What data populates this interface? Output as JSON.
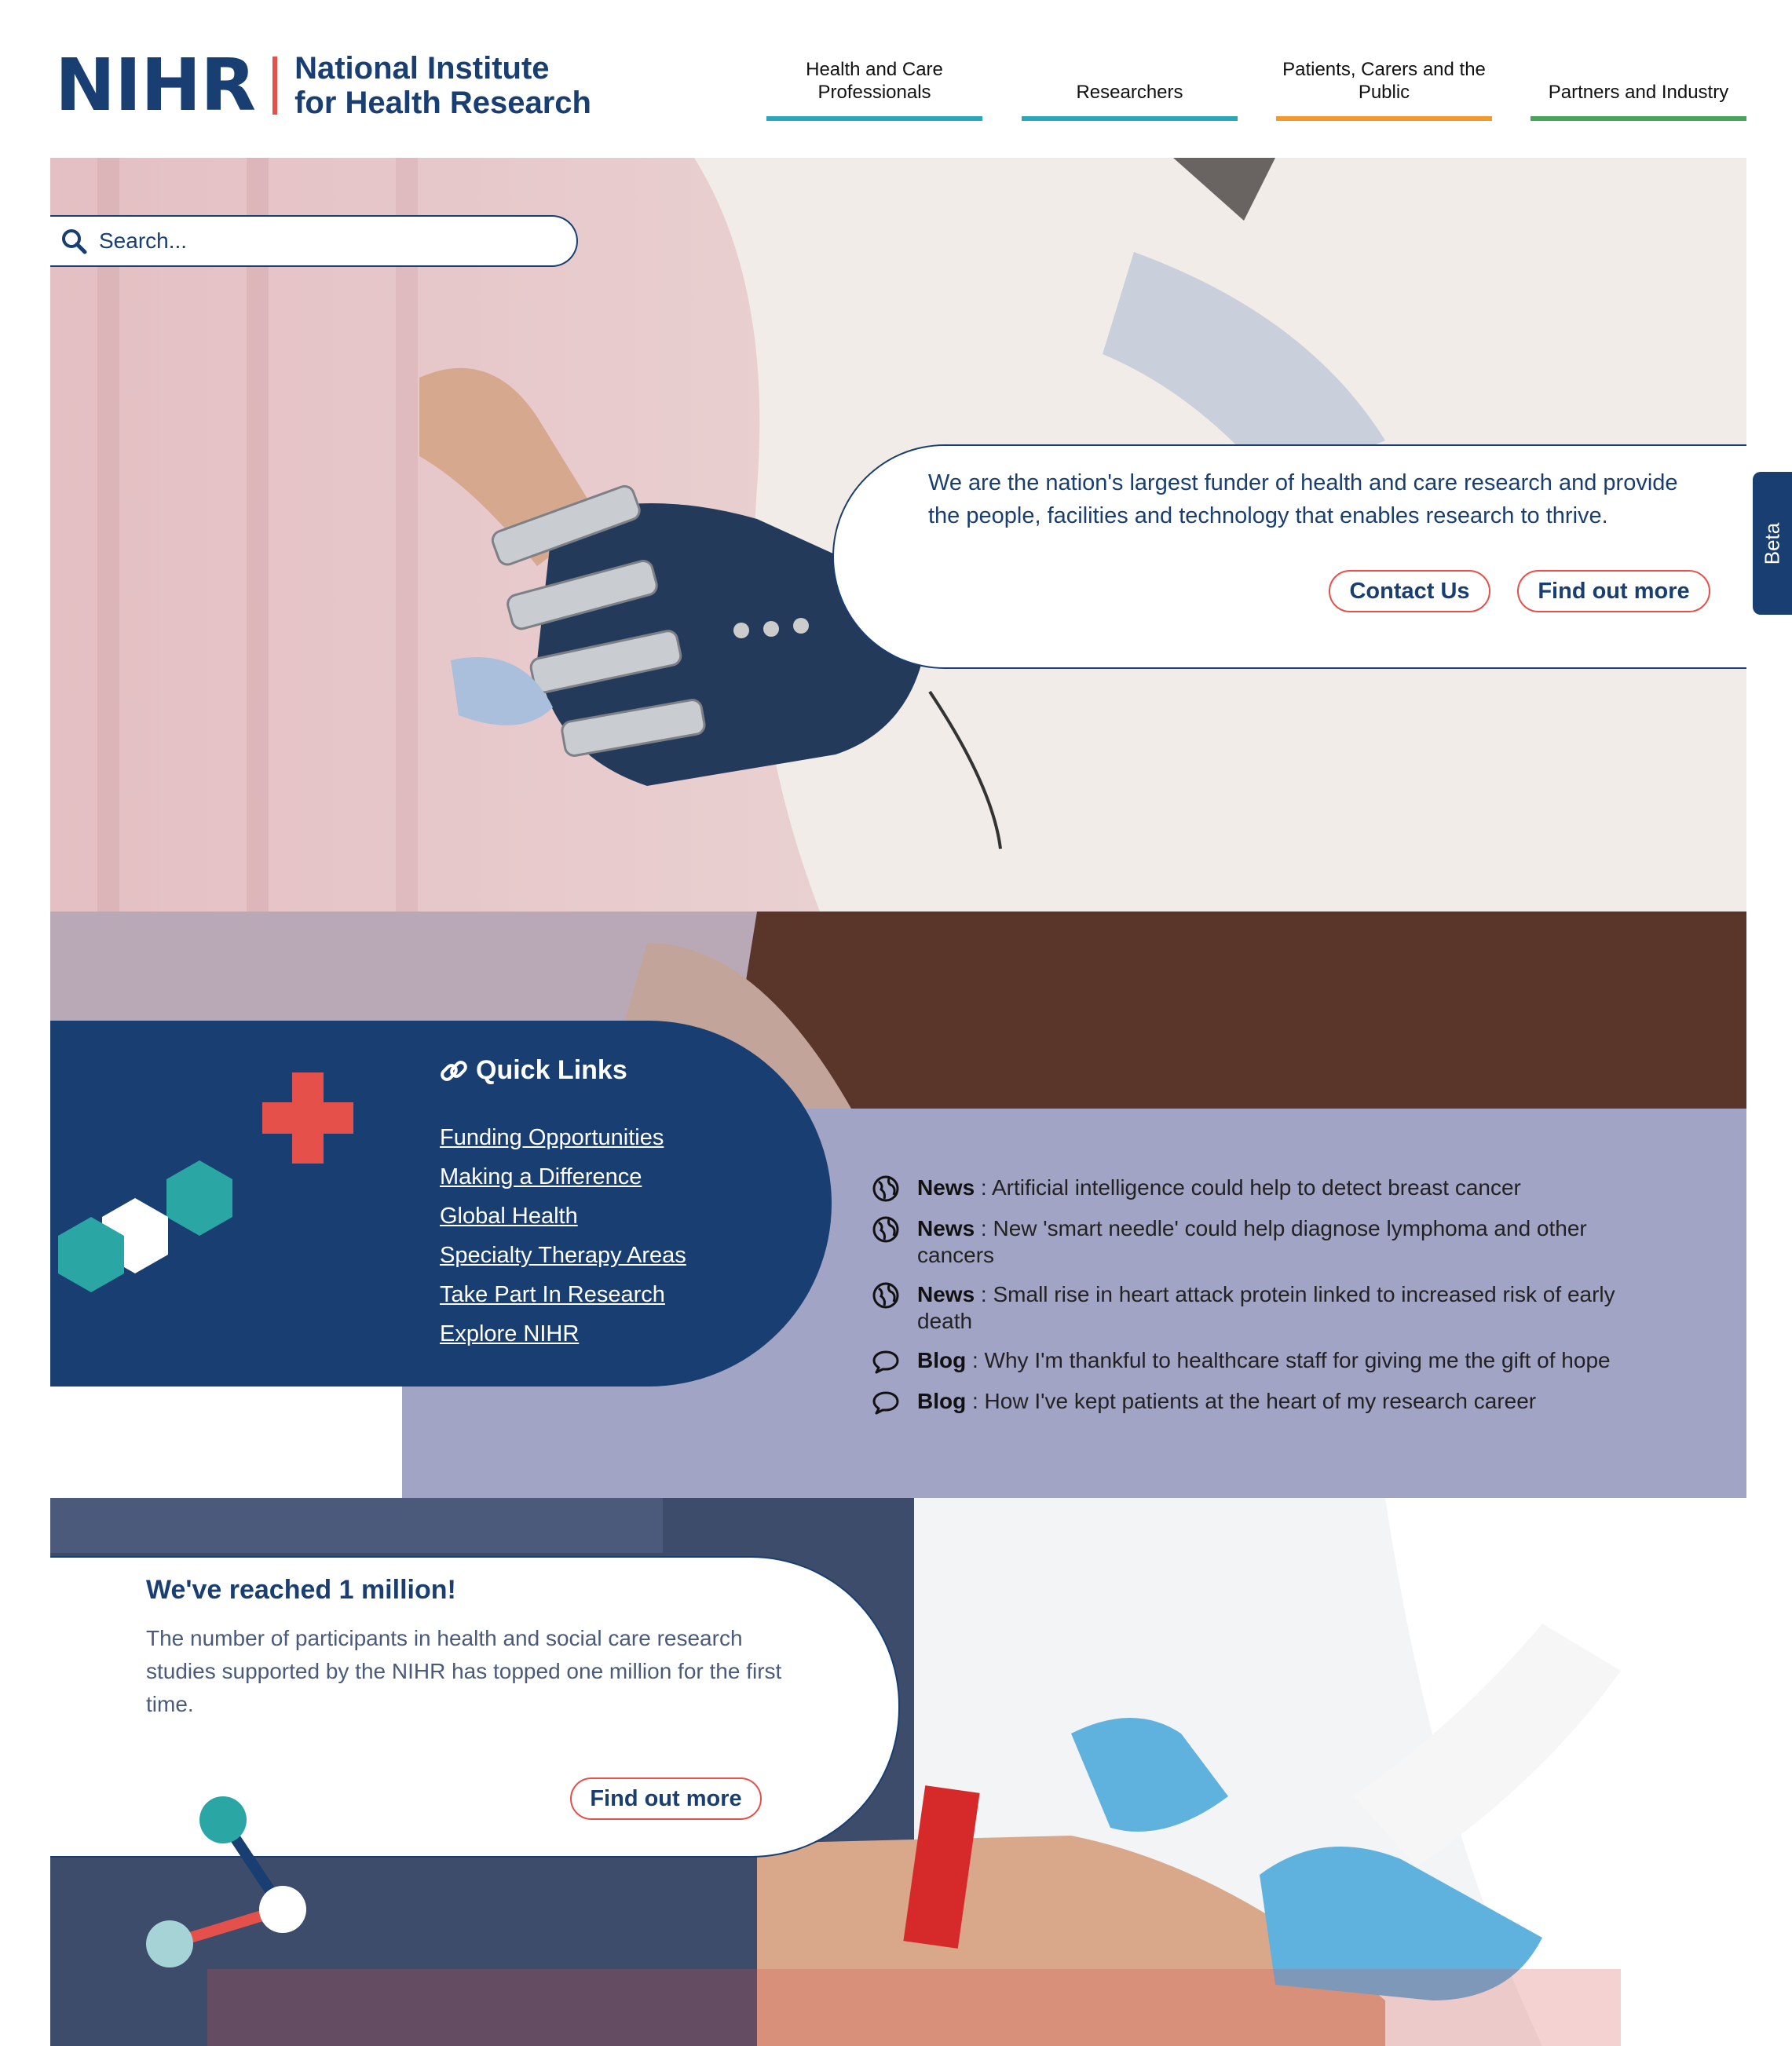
{
  "header": {
    "logo_mark": "NIHR",
    "logo_line1": "National Institute",
    "logo_line2": "for Health Research"
  },
  "nav": {
    "items": [
      {
        "label": "Health and Care Professionals",
        "color": "#2aa7b8"
      },
      {
        "label": "Researchers",
        "color": "#2aa7b8"
      },
      {
        "label": "Patients, Carers and the Public",
        "color": "#f39a2b"
      },
      {
        "label": "Partners and Industry",
        "color": "#46a55a"
      }
    ]
  },
  "search": {
    "placeholder": "Search..."
  },
  "hero": {
    "mission": "We are the nation's largest funder of health and care research and provide the people, facilities and technology that enables research to thrive.",
    "contact_label": "Contact Us",
    "find_out_label": "Find out more"
  },
  "beta_tab": "Beta",
  "quick_links": {
    "title": "Quick Links",
    "items": [
      "Funding Opportunities",
      "Making a Difference",
      "Global Health",
      "Specialty Therapy Areas",
      "Take Part In Research",
      "Explore NIHR"
    ]
  },
  "news": {
    "items": [
      {
        "type": "News",
        "icon": "globe-icon",
        "text": " : Artificial intelligence could help to detect breast cancer"
      },
      {
        "type": "News",
        "icon": "globe-icon",
        "text": " : New 'smart needle' could help diagnose lymphoma and other cancers"
      },
      {
        "type": "News",
        "icon": "globe-icon",
        "text": " : Small rise in heart attack protein linked to increased risk of early death"
      },
      {
        "type": "Blog",
        "icon": "speech-bubble-icon",
        "text": " : Why I'm thankful to healthcare staff for giving me the gift of hope"
      },
      {
        "type": "Blog",
        "icon": "speech-bubble-icon",
        "text": " : How I've kept patients at the heart of my research career"
      }
    ]
  },
  "milestone": {
    "title": "We've reached 1 million!",
    "text": "The number of participants in health and social care research studies supported by the NIHR has topped one million for the first time.",
    "button_label": "Find out more"
  },
  "colors": {
    "navy": "#193e72",
    "coral": "#e5514a",
    "teal": "#2aa7b8",
    "lavender": "#a2a4c5"
  }
}
